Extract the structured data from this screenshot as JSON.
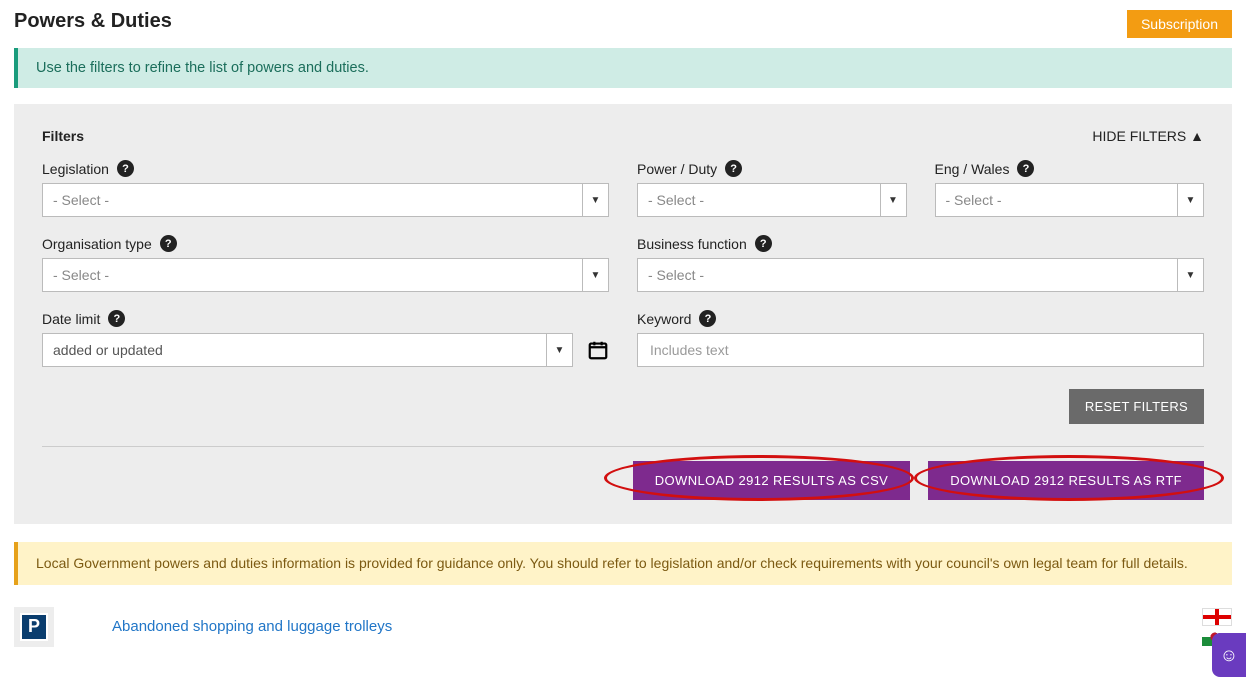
{
  "header": {
    "title": "Powers & Duties",
    "subscription_label": "Subscription"
  },
  "info_banner": "Use the filters to refine the list of powers and duties.",
  "filters": {
    "heading": "Filters",
    "hide_label": "HIDE FILTERS ▲",
    "legislation": {
      "label": "Legislation",
      "value": "- Select -"
    },
    "power_duty": {
      "label": "Power / Duty",
      "value": "- Select -"
    },
    "eng_wales": {
      "label": "Eng / Wales",
      "value": "- Select -"
    },
    "org_type": {
      "label": "Organisation type",
      "value": "- Select -"
    },
    "business_function": {
      "label": "Business function",
      "value": "- Select -"
    },
    "date_limit": {
      "label": "Date limit",
      "value": "added or updated"
    },
    "keyword": {
      "label": "Keyword",
      "placeholder": "Includes text"
    },
    "reset_label": "RESET FILTERS",
    "download_csv": "DOWNLOAD 2912 RESULTS AS CSV",
    "download_rtf": "DOWNLOAD 2912 RESULTS AS RTF"
  },
  "warning_banner": "Local Government powers and duties information is provided for guidance only. You should refer to legislation and/or check requirements with your council's own legal team for full details.",
  "results": [
    {
      "badge": "P",
      "title": "Abandoned shopping and luggage trolleys",
      "flags": [
        "england",
        "wales"
      ]
    }
  ]
}
